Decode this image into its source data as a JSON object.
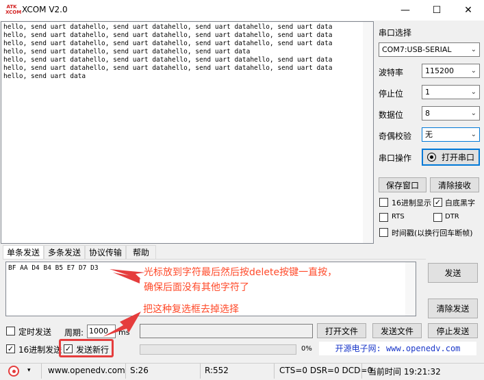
{
  "window": {
    "logo_text": "ATK XCOM",
    "title": "XCOM V2.0",
    "minimize_glyph": "—",
    "maximize_glyph": "☐",
    "close_glyph": "✕"
  },
  "receive": {
    "text": "hello, send uart datahello, send uart datahello, send uart datahello, send uart data\nhello, send uart datahello, send uart datahello, send uart datahello, send uart data\nhello, send uart datahello, send uart datahello, send uart datahello, send uart data\nhello, send uart datahello, send uart datahello, send uart data\nhello, send uart datahello, send uart datahello, send uart datahello, send uart data\nhello, send uart datahello, send uart datahello, send uart datahello, send uart data\nhello, send uart data"
  },
  "panel": {
    "port_select_label": "串口选择",
    "port_value": "COM7:USB-SERIAL",
    "baud_label": "波特率",
    "baud_value": "115200",
    "stop_label": "停止位",
    "stop_value": "1",
    "data_label": "数据位",
    "data_value": "8",
    "parity_label": "奇偶校验",
    "parity_value": "无",
    "op_label": "串口操作",
    "open_port": "打开串口",
    "save_window": "保存窗口",
    "clear_receive": "清除接收",
    "hex_display": "16进制显示",
    "hex_display_checked": false,
    "white_bg": "白底黑字",
    "white_bg_checked": true,
    "rts": "RTS",
    "rts_checked": false,
    "dtr": "DTR",
    "dtr_checked": false,
    "timestamp": "时间戳(以换行回车断帧)",
    "timestamp_checked": false
  },
  "tabs": [
    "单条发送",
    "多条发送",
    "协议传输",
    "帮助"
  ],
  "send": {
    "text": "BF AA D4 B4 B5 E7 D7 D3",
    "send_button": "发送",
    "clear_send": "清除发送",
    "timed_send": "定时发送",
    "timed_send_checked": false,
    "period_label": "周期:",
    "period_value": "1000",
    "period_unit": "ms",
    "open_file": "打开文件",
    "send_file": "发送文件",
    "stop_send": "停止发送",
    "hex_send": "16进制发送",
    "hex_send_checked": true,
    "send_newline": "发送新行",
    "send_newline_checked": true,
    "progress": 0,
    "progress_text": "0%",
    "website_banner": "开源电子网: www.openedv.com"
  },
  "annotations": {
    "note1_line1": "光标放到字符最后然后按delete按键一直按，",
    "note1_line2": "确保后面没有其他字符了",
    "note2": "把这种复选框去掉选择",
    "color": "#ff4a2a"
  },
  "statusbar": {
    "website": "www.openedv.com",
    "sent": "S:26",
    "received": "R:552",
    "lines": "CTS=0 DSR=0 DCD=0",
    "time": "当前时间 19:21:32"
  }
}
